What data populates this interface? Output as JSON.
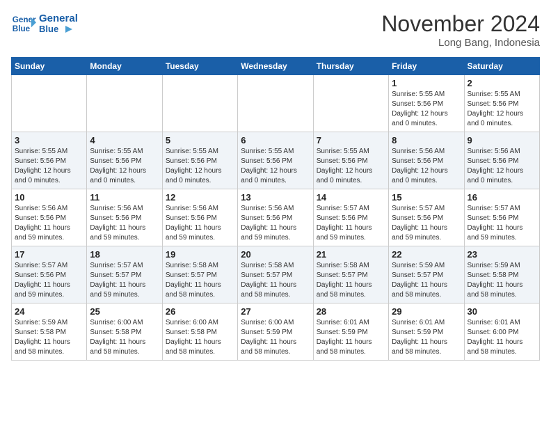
{
  "header": {
    "logo_line1": "General",
    "logo_line2": "Blue",
    "month": "November 2024",
    "location": "Long Bang, Indonesia"
  },
  "weekdays": [
    "Sunday",
    "Monday",
    "Tuesday",
    "Wednesday",
    "Thursday",
    "Friday",
    "Saturday"
  ],
  "weeks": [
    [
      {
        "day": "",
        "info": ""
      },
      {
        "day": "",
        "info": ""
      },
      {
        "day": "",
        "info": ""
      },
      {
        "day": "",
        "info": ""
      },
      {
        "day": "",
        "info": ""
      },
      {
        "day": "1",
        "info": "Sunrise: 5:55 AM\nSunset: 5:56 PM\nDaylight: 12 hours\nand 0 minutes."
      },
      {
        "day": "2",
        "info": "Sunrise: 5:55 AM\nSunset: 5:56 PM\nDaylight: 12 hours\nand 0 minutes."
      }
    ],
    [
      {
        "day": "3",
        "info": "Sunrise: 5:55 AM\nSunset: 5:56 PM\nDaylight: 12 hours\nand 0 minutes."
      },
      {
        "day": "4",
        "info": "Sunrise: 5:55 AM\nSunset: 5:56 PM\nDaylight: 12 hours\nand 0 minutes."
      },
      {
        "day": "5",
        "info": "Sunrise: 5:55 AM\nSunset: 5:56 PM\nDaylight: 12 hours\nand 0 minutes."
      },
      {
        "day": "6",
        "info": "Sunrise: 5:55 AM\nSunset: 5:56 PM\nDaylight: 12 hours\nand 0 minutes."
      },
      {
        "day": "7",
        "info": "Sunrise: 5:55 AM\nSunset: 5:56 PM\nDaylight: 12 hours\nand 0 minutes."
      },
      {
        "day": "8",
        "info": "Sunrise: 5:56 AM\nSunset: 5:56 PM\nDaylight: 12 hours\nand 0 minutes."
      },
      {
        "day": "9",
        "info": "Sunrise: 5:56 AM\nSunset: 5:56 PM\nDaylight: 12 hours\nand 0 minutes."
      }
    ],
    [
      {
        "day": "10",
        "info": "Sunrise: 5:56 AM\nSunset: 5:56 PM\nDaylight: 11 hours\nand 59 minutes."
      },
      {
        "day": "11",
        "info": "Sunrise: 5:56 AM\nSunset: 5:56 PM\nDaylight: 11 hours\nand 59 minutes."
      },
      {
        "day": "12",
        "info": "Sunrise: 5:56 AM\nSunset: 5:56 PM\nDaylight: 11 hours\nand 59 minutes."
      },
      {
        "day": "13",
        "info": "Sunrise: 5:56 AM\nSunset: 5:56 PM\nDaylight: 11 hours\nand 59 minutes."
      },
      {
        "day": "14",
        "info": "Sunrise: 5:57 AM\nSunset: 5:56 PM\nDaylight: 11 hours\nand 59 minutes."
      },
      {
        "day": "15",
        "info": "Sunrise: 5:57 AM\nSunset: 5:56 PM\nDaylight: 11 hours\nand 59 minutes."
      },
      {
        "day": "16",
        "info": "Sunrise: 5:57 AM\nSunset: 5:56 PM\nDaylight: 11 hours\nand 59 minutes."
      }
    ],
    [
      {
        "day": "17",
        "info": "Sunrise: 5:57 AM\nSunset: 5:56 PM\nDaylight: 11 hours\nand 59 minutes."
      },
      {
        "day": "18",
        "info": "Sunrise: 5:57 AM\nSunset: 5:57 PM\nDaylight: 11 hours\nand 59 minutes."
      },
      {
        "day": "19",
        "info": "Sunrise: 5:58 AM\nSunset: 5:57 PM\nDaylight: 11 hours\nand 58 minutes."
      },
      {
        "day": "20",
        "info": "Sunrise: 5:58 AM\nSunset: 5:57 PM\nDaylight: 11 hours\nand 58 minutes."
      },
      {
        "day": "21",
        "info": "Sunrise: 5:58 AM\nSunset: 5:57 PM\nDaylight: 11 hours\nand 58 minutes."
      },
      {
        "day": "22",
        "info": "Sunrise: 5:59 AM\nSunset: 5:57 PM\nDaylight: 11 hours\nand 58 minutes."
      },
      {
        "day": "23",
        "info": "Sunrise: 5:59 AM\nSunset: 5:58 PM\nDaylight: 11 hours\nand 58 minutes."
      }
    ],
    [
      {
        "day": "24",
        "info": "Sunrise: 5:59 AM\nSunset: 5:58 PM\nDaylight: 11 hours\nand 58 minutes."
      },
      {
        "day": "25",
        "info": "Sunrise: 6:00 AM\nSunset: 5:58 PM\nDaylight: 11 hours\nand 58 minutes."
      },
      {
        "day": "26",
        "info": "Sunrise: 6:00 AM\nSunset: 5:58 PM\nDaylight: 11 hours\nand 58 minutes."
      },
      {
        "day": "27",
        "info": "Sunrise: 6:00 AM\nSunset: 5:59 PM\nDaylight: 11 hours\nand 58 minutes."
      },
      {
        "day": "28",
        "info": "Sunrise: 6:01 AM\nSunset: 5:59 PM\nDaylight: 11 hours\nand 58 minutes."
      },
      {
        "day": "29",
        "info": "Sunrise: 6:01 AM\nSunset: 5:59 PM\nDaylight: 11 hours\nand 58 minutes."
      },
      {
        "day": "30",
        "info": "Sunrise: 6:01 AM\nSunset: 6:00 PM\nDaylight: 11 hours\nand 58 minutes."
      }
    ]
  ]
}
